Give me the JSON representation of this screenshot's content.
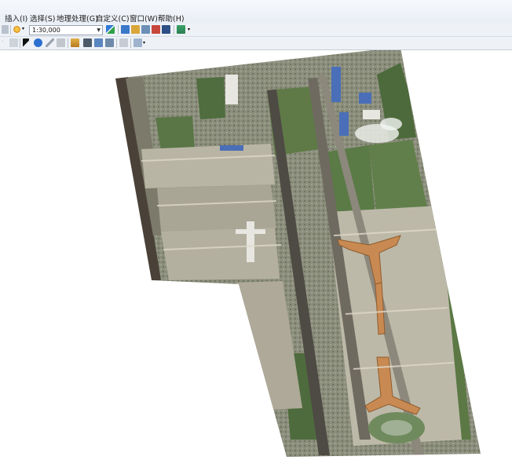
{
  "menu": {
    "items": [
      "插入(I)",
      "选择(S)",
      "地理处理(G)",
      "自定义(C)",
      "窗口(W)",
      "帮助(H)"
    ]
  },
  "toolbar": {
    "scale_value": "1:30,000",
    "icons": [
      "undo-icon",
      "add-data-icon",
      "zoom-icon",
      "layers-icon",
      "catalog-icon",
      "toolbox-icon",
      "python-icon",
      "arcmap-icon",
      "model-icon",
      "select-icon",
      "identify-icon",
      "pencil-icon",
      "edit-icon",
      "measure-icon",
      "binoculars-icon",
      "route-icon",
      "gps-icon",
      "window-icon",
      "table-icon"
    ]
  },
  "colors": {
    "menubar_bg": "#eef2f7",
    "map_bg": "#ffffff",
    "imagery_dark": "#5b6a4e",
    "imagery_light": "#c8c3b2",
    "terminal_orange": "#c88a52",
    "building_blue": "#4a6fb8"
  }
}
